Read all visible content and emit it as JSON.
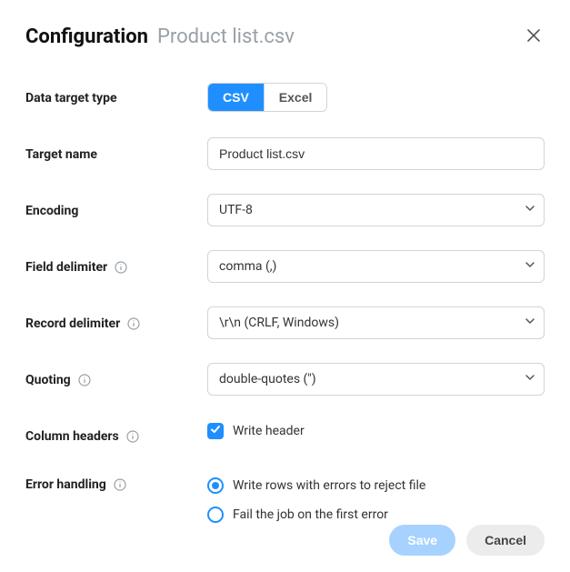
{
  "header": {
    "title": "Configuration",
    "subtitle": "Product list.csv"
  },
  "labels": {
    "data_target_type": "Data target type",
    "target_name": "Target name",
    "encoding": "Encoding",
    "field_delimiter": "Field delimiter",
    "record_delimiter": "Record delimiter",
    "quoting": "Quoting",
    "column_headers": "Column headers",
    "error_handling": "Error handling"
  },
  "data_target_type": {
    "options": [
      "CSV",
      "Excel"
    ],
    "selected": "CSV",
    "csv_label": "CSV",
    "excel_label": "Excel"
  },
  "target_name": {
    "value": "Product list.csv"
  },
  "encoding": {
    "value": "UTF-8"
  },
  "field_delimiter": {
    "value": "comma (,)"
  },
  "record_delimiter": {
    "value": "\\r\\n (CRLF, Windows)"
  },
  "quoting": {
    "value": "double-quotes (\")"
  },
  "column_headers": {
    "checkbox_label": "Write header",
    "checked": true
  },
  "error_handling": {
    "options": {
      "reject_file": "Write rows with errors to reject file",
      "fail_first": "Fail the job on the first error"
    },
    "selected": "reject_file"
  },
  "footer": {
    "save": "Save",
    "cancel": "Cancel"
  }
}
